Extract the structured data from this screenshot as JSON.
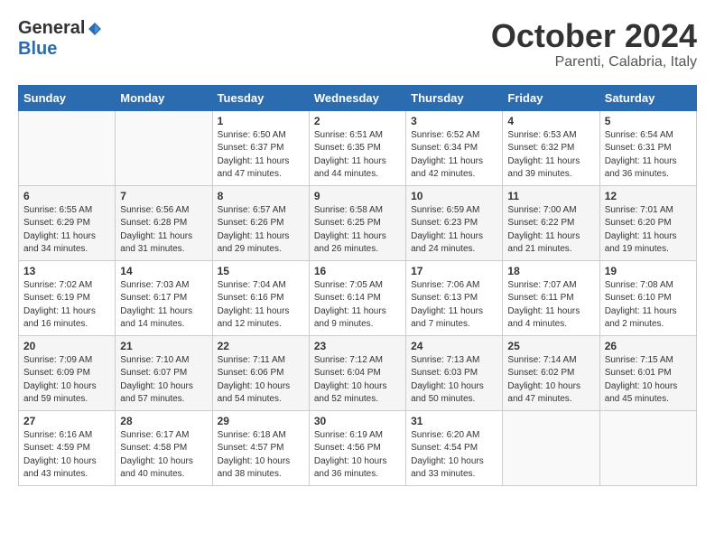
{
  "logo": {
    "general": "General",
    "blue": "Blue"
  },
  "header": {
    "month": "October 2024",
    "location": "Parenti, Calabria, Italy"
  },
  "weekdays": [
    "Sunday",
    "Monday",
    "Tuesday",
    "Wednesday",
    "Thursday",
    "Friday",
    "Saturday"
  ],
  "weeks": [
    [
      {
        "day": "",
        "info": ""
      },
      {
        "day": "",
        "info": ""
      },
      {
        "day": "1",
        "info": "Sunrise: 6:50 AM\nSunset: 6:37 PM\nDaylight: 11 hours and 47 minutes."
      },
      {
        "day": "2",
        "info": "Sunrise: 6:51 AM\nSunset: 6:35 PM\nDaylight: 11 hours and 44 minutes."
      },
      {
        "day": "3",
        "info": "Sunrise: 6:52 AM\nSunset: 6:34 PM\nDaylight: 11 hours and 42 minutes."
      },
      {
        "day": "4",
        "info": "Sunrise: 6:53 AM\nSunset: 6:32 PM\nDaylight: 11 hours and 39 minutes."
      },
      {
        "day": "5",
        "info": "Sunrise: 6:54 AM\nSunset: 6:31 PM\nDaylight: 11 hours and 36 minutes."
      }
    ],
    [
      {
        "day": "6",
        "info": "Sunrise: 6:55 AM\nSunset: 6:29 PM\nDaylight: 11 hours and 34 minutes."
      },
      {
        "day": "7",
        "info": "Sunrise: 6:56 AM\nSunset: 6:28 PM\nDaylight: 11 hours and 31 minutes."
      },
      {
        "day": "8",
        "info": "Sunrise: 6:57 AM\nSunset: 6:26 PM\nDaylight: 11 hours and 29 minutes."
      },
      {
        "day": "9",
        "info": "Sunrise: 6:58 AM\nSunset: 6:25 PM\nDaylight: 11 hours and 26 minutes."
      },
      {
        "day": "10",
        "info": "Sunrise: 6:59 AM\nSunset: 6:23 PM\nDaylight: 11 hours and 24 minutes."
      },
      {
        "day": "11",
        "info": "Sunrise: 7:00 AM\nSunset: 6:22 PM\nDaylight: 11 hours and 21 minutes."
      },
      {
        "day": "12",
        "info": "Sunrise: 7:01 AM\nSunset: 6:20 PM\nDaylight: 11 hours and 19 minutes."
      }
    ],
    [
      {
        "day": "13",
        "info": "Sunrise: 7:02 AM\nSunset: 6:19 PM\nDaylight: 11 hours and 16 minutes."
      },
      {
        "day": "14",
        "info": "Sunrise: 7:03 AM\nSunset: 6:17 PM\nDaylight: 11 hours and 14 minutes."
      },
      {
        "day": "15",
        "info": "Sunrise: 7:04 AM\nSunset: 6:16 PM\nDaylight: 11 hours and 12 minutes."
      },
      {
        "day": "16",
        "info": "Sunrise: 7:05 AM\nSunset: 6:14 PM\nDaylight: 11 hours and 9 minutes."
      },
      {
        "day": "17",
        "info": "Sunrise: 7:06 AM\nSunset: 6:13 PM\nDaylight: 11 hours and 7 minutes."
      },
      {
        "day": "18",
        "info": "Sunrise: 7:07 AM\nSunset: 6:11 PM\nDaylight: 11 hours and 4 minutes."
      },
      {
        "day": "19",
        "info": "Sunrise: 7:08 AM\nSunset: 6:10 PM\nDaylight: 11 hours and 2 minutes."
      }
    ],
    [
      {
        "day": "20",
        "info": "Sunrise: 7:09 AM\nSunset: 6:09 PM\nDaylight: 10 hours and 59 minutes."
      },
      {
        "day": "21",
        "info": "Sunrise: 7:10 AM\nSunset: 6:07 PM\nDaylight: 10 hours and 57 minutes."
      },
      {
        "day": "22",
        "info": "Sunrise: 7:11 AM\nSunset: 6:06 PM\nDaylight: 10 hours and 54 minutes."
      },
      {
        "day": "23",
        "info": "Sunrise: 7:12 AM\nSunset: 6:04 PM\nDaylight: 10 hours and 52 minutes."
      },
      {
        "day": "24",
        "info": "Sunrise: 7:13 AM\nSunset: 6:03 PM\nDaylight: 10 hours and 50 minutes."
      },
      {
        "day": "25",
        "info": "Sunrise: 7:14 AM\nSunset: 6:02 PM\nDaylight: 10 hours and 47 minutes."
      },
      {
        "day": "26",
        "info": "Sunrise: 7:15 AM\nSunset: 6:01 PM\nDaylight: 10 hours and 45 minutes."
      }
    ],
    [
      {
        "day": "27",
        "info": "Sunrise: 6:16 AM\nSunset: 4:59 PM\nDaylight: 10 hours and 43 minutes."
      },
      {
        "day": "28",
        "info": "Sunrise: 6:17 AM\nSunset: 4:58 PM\nDaylight: 10 hours and 40 minutes."
      },
      {
        "day": "29",
        "info": "Sunrise: 6:18 AM\nSunset: 4:57 PM\nDaylight: 10 hours and 38 minutes."
      },
      {
        "day": "30",
        "info": "Sunrise: 6:19 AM\nSunset: 4:56 PM\nDaylight: 10 hours and 36 minutes."
      },
      {
        "day": "31",
        "info": "Sunrise: 6:20 AM\nSunset: 4:54 PM\nDaylight: 10 hours and 33 minutes."
      },
      {
        "day": "",
        "info": ""
      },
      {
        "day": "",
        "info": ""
      }
    ]
  ]
}
